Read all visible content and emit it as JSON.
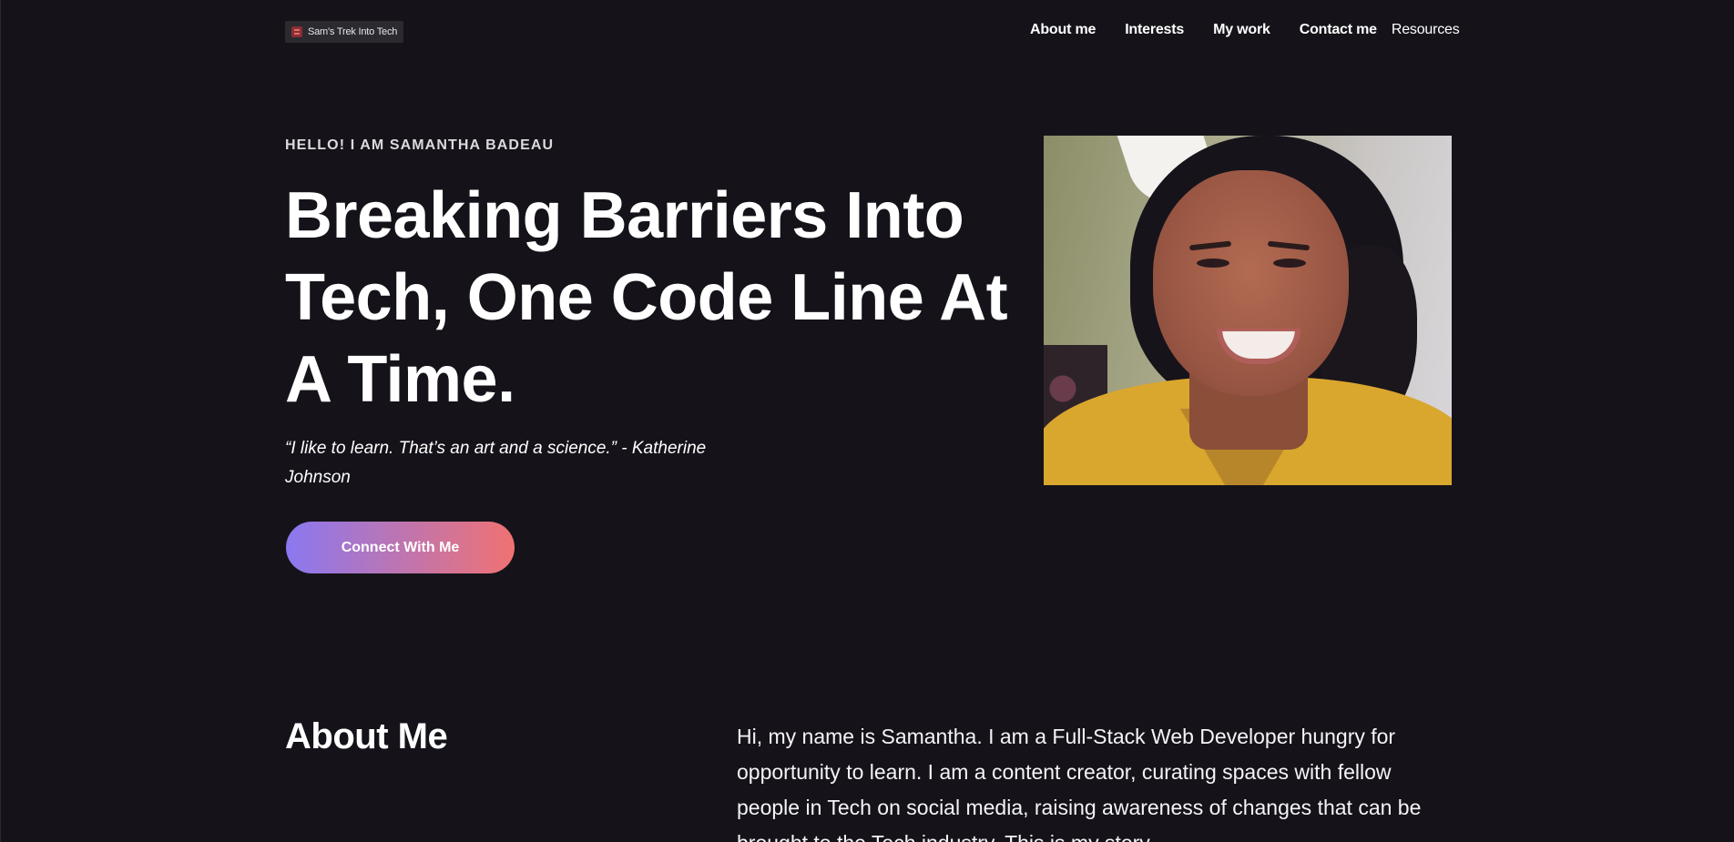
{
  "header": {
    "logo_text": "Sam's Trek Into Tech",
    "nav": [
      "About me",
      "Interests",
      "My work",
      "Contact me",
      "Resources"
    ]
  },
  "hero": {
    "eyebrow": "HELLO! I AM SAMANTHA BADEAU",
    "title": "Breaking Barriers Into Tech, One Code Line At A Time.",
    "quote": "“I like to learn. That’s an art and a science.” - Katherine Johnson",
    "cta_label": "Connect With Me"
  },
  "about": {
    "title": "About Me",
    "text": "Hi, my name is Samantha. I am a Full-Stack Web Developer hungry for opportunity to learn. I am a content creator, curating spaces with fellow people in Tech on social media, raising awareness of changes that can be brought to the Tech industry. This is my story."
  },
  "colors": {
    "background": "#151319",
    "cta_gradient_start": "#8a78f0",
    "cta_gradient_end": "#f07272"
  }
}
